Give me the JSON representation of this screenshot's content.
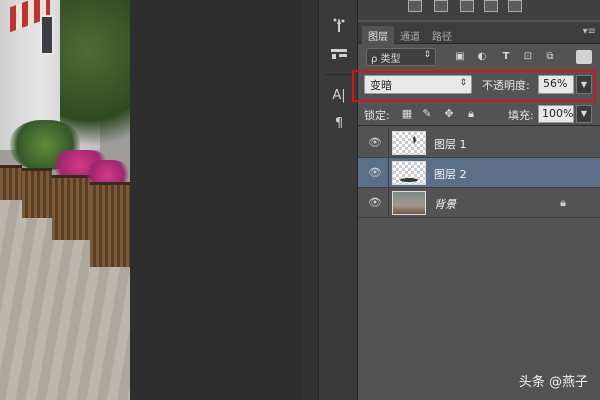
{
  "tabs": [
    {
      "label": "图层",
      "active": true
    },
    {
      "label": "通道",
      "active": false
    },
    {
      "label": "路径",
      "active": false
    }
  ],
  "panel_menu_icon": "menu-icon",
  "filter": {
    "kind_label": "ρ 类型",
    "icons": [
      "pixel-filter-icon",
      "adjustment-filter-icon",
      "type-filter-icon",
      "shape-filter-icon",
      "smartobject-filter-icon"
    ]
  },
  "blend": {
    "mode": "变暗",
    "opacity_label": "不透明度:",
    "opacity_value": "56%"
  },
  "lock": {
    "label": "锁定:",
    "fill_label": "填充:",
    "fill_value": "100%"
  },
  "layers": [
    {
      "name": "图层 1",
      "selected": false,
      "visible": true
    },
    {
      "name": "图层 2",
      "selected": true,
      "visible": true
    },
    {
      "name": "背景",
      "selected": false,
      "visible": true,
      "locked": true
    }
  ],
  "tools": [
    "brush-settings-icon",
    "brush-presets-icon",
    "character-icon",
    "paragraph-icon"
  ],
  "tool_labels": {
    "character": "A|",
    "paragraph": "¶"
  },
  "watermark": "头条 @燕子",
  "colors": {
    "highlight": "#d0161a",
    "selected_row": "#5b6f89"
  }
}
